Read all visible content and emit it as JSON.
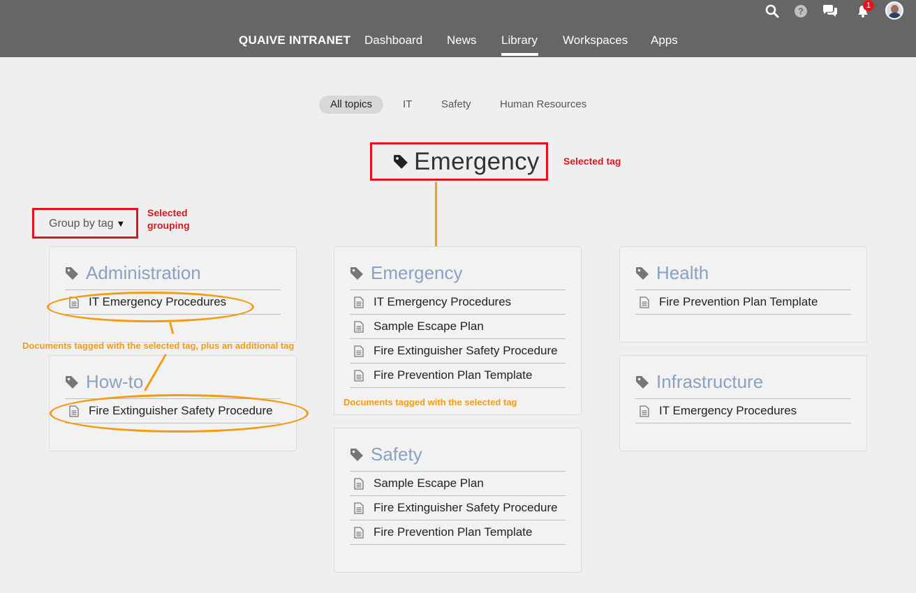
{
  "nav": {
    "brand": "QUAIVE INTRANET",
    "items": [
      "Dashboard",
      "News",
      "Library",
      "Workspaces",
      "Apps"
    ],
    "active": "Library"
  },
  "toolbar": {
    "notification_count": "1"
  },
  "topics": [
    "All topics",
    "IT",
    "Safety",
    "Human Resources"
  ],
  "selected_tag": "Emergency",
  "group_by_label": "Group by tag",
  "annotations": {
    "selected_tag": "Selected tag",
    "selected_grouping": "Selected grouping",
    "additional_tag": "Documents tagged with the selected tag, plus an additional tag",
    "selected_tag_docs": "Documents tagged with the selected tag"
  },
  "groups": [
    {
      "title": "Administration",
      "docs": [
        "IT Emergency Procedures"
      ]
    },
    {
      "title": "How-to",
      "docs": [
        "Fire Extinguisher Safety Procedure"
      ]
    },
    {
      "title": "Emergency",
      "docs": [
        "IT Emergency Procedures",
        "Sample Escape Plan",
        "Fire Extinguisher Safety Procedure",
        "Fire Prevention Plan Template"
      ]
    },
    {
      "title": "Safety",
      "docs": [
        "Sample Escape Plan",
        "Fire Extinguisher Safety Procedure",
        "Fire Prevention Plan Template"
      ]
    },
    {
      "title": "Health",
      "docs": [
        "Fire Prevention Plan Template"
      ]
    },
    {
      "title": "Infrastructure",
      "docs": [
        "IT Emergency Procedures"
      ]
    }
  ],
  "colors": {
    "topbar": "#666666",
    "tag_title": "#8aa1c2",
    "annotation_red": "#e0131e",
    "annotation_orange": "#f39c12"
  }
}
